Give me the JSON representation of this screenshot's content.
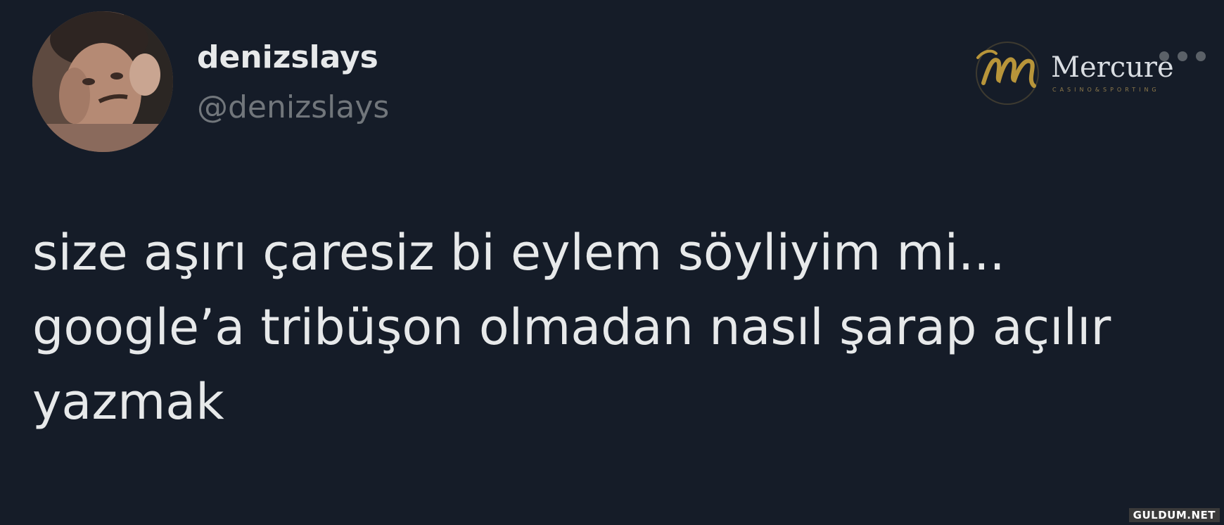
{
  "author": {
    "display_name": "denizslays",
    "handle": "@denizslays"
  },
  "tweet": {
    "lines": [
      "size aşırı çaresiz bi eylem söyliyim mi...",
      "google’a tribüşon olmadan nasıl şarap açılır",
      "yazmak"
    ]
  },
  "overlay_logo": {
    "brand": "Mercure",
    "subtitle": "CASINO&SPORTING",
    "accent_color": "#b8953a"
  },
  "watermark": "GULDUM.NET",
  "colors": {
    "background": "#151c28",
    "text_primary": "#e7e9ea",
    "text_secondary": "#71767b"
  },
  "icons": {
    "more": "more-horizontal-icon",
    "avatar": "profile-photo"
  }
}
